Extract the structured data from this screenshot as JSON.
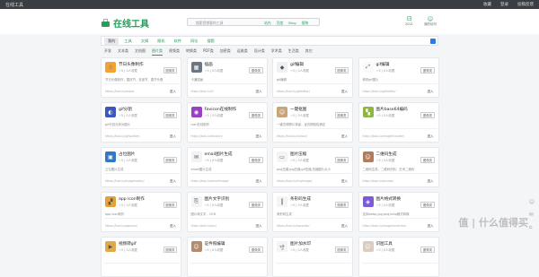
{
  "topbar": {
    "title": "在线工具",
    "links": [
      "收藏",
      "登录",
      "投稿反馈"
    ]
  },
  "header": {
    "logo_text": "在线工具",
    "search_placeholder": "搜索您想要的工具",
    "search_tabs": [
      "站内",
      "百度",
      "Bing",
      "搜狗"
    ],
    "date_label": "2021",
    "date_glyph": "日",
    "visitor_label": "我的访问",
    "visitor_glyph": "☺"
  },
  "nav": {
    "items": [
      "我的",
      "工具",
      "文摘",
      "随机",
      "软件",
      "网址",
      "搜题"
    ]
  },
  "subnav": {
    "items": [
      "开发",
      "文本类",
      "文档图",
      "图片类",
      "视频类",
      "转换类",
      "PDF类",
      "加密类",
      "运维类",
      "设计类",
      "学术类",
      "生活类",
      "其它"
    ]
  },
  "cards": [
    {
      "name": "节日头像制作",
      "meta": "☆5 | 0人收藏",
      "tag": "图像类",
      "desc": "节日头像制作，国庆节、圣诞节、春节头像",
      "url": "https://tool.lu/avatar",
      "go": "进入",
      "color": "#f3a238",
      "glyph": "☃"
    },
    {
      "name": "插画",
      "meta": "☆5 | 0人收藏",
      "tag": "图像类",
      "desc": "卡通插画",
      "url": "https://tool.lu/ill",
      "go": "进入",
      "color": "#6b7784",
      "glyph": "▦"
    },
    {
      "name": "gif编辑",
      "meta": "☆5 | 0人收藏",
      "tag": "图像类",
      "desc": "gif编辑",
      "url": "https://tool.lu/gifeditor/",
      "go": "进入",
      "color": "#eef0f3",
      "glyph": "◆"
    },
    {
      "name": "gif编辑",
      "meta": "☆5 | 0人收藏",
      "tag": "图像类",
      "desc": "修改gif图片",
      "url": "https://tool.lu/gifeditor/",
      "go": "进入",
      "color": "#fafafa",
      "glyph": "⤢"
    },
    {
      "name": "gif分割",
      "meta": "☆5 | 0人收藏",
      "tag": "图像类",
      "desc": "gif分割分拆为图片",
      "url": "https://tool.lu/gifsplitter/",
      "go": "进入",
      "color": "#3a57c4",
      "glyph": "◐"
    },
    {
      "name": "Favicon在线制作",
      "meta": "☆5 | 0人收藏",
      "tag": "图像类",
      "desc": "icon在线制作",
      "url": "https://tool.lu/favicon/",
      "go": "进入",
      "color": "#9b3fc6",
      "glyph": "◉"
    },
    {
      "name": "一键抠图",
      "meta": "☆5 | 0人收藏",
      "tag": "图像类",
      "desc": "一键去掉照片背景，证件照轻松搞定",
      "url": "https://tool.lu/cutout/",
      "go": "进入",
      "color": "#c9a37a",
      "glyph": "☺"
    },
    {
      "name": "图片base64编码",
      "meta": "☆5 | 0人收藏",
      "tag": "图像类",
      "desc": "",
      "url": "https://tool.lu/imageEncoder/",
      "go": "进入",
      "color": "#8fb547",
      "glyph": "▚"
    },
    {
      "name": "占位图片",
      "meta": "☆5 | 0人收藏",
      "tag": "图像类",
      "desc": "占位图片生成",
      "url": "https://tool.lu/imageholder/",
      "go": "进入",
      "color": "#3178c6",
      "glyph": "▣"
    },
    {
      "name": "email图片生成",
      "meta": "☆5 | 0人收藏",
      "tag": "图像类",
      "desc": "email图片生成",
      "url": "https://tool.lu/emailimage/",
      "go": "进入",
      "color": "#f2f2f2",
      "glyph": "✉"
    },
    {
      "name": "图片压缩",
      "meta": "☆5 | 0人收藏",
      "tag": "图像类",
      "desc": "png压缩,jpg压缩,gif压缩,压缩图片大小",
      "url": "https://tool.lu/tinyimage/",
      "go": "进入",
      "color": "#f4f4f4",
      "glyph": "▭"
    },
    {
      "name": "二维码生成",
      "meta": "☆5 | 0人收藏",
      "tag": "图像类",
      "desc": "二维码生成，二维码识别，艺术二维码",
      "url": "https://tool.lu/qrcode/",
      "go": "进入",
      "color": "#b07c5c",
      "glyph": "☺"
    },
    {
      "name": "app icon制作",
      "meta": "☆5 | 0人收藏",
      "tag": "图像类",
      "desc": "app icon制作",
      "url": "https://tool.lu/appicon/",
      "go": "进入",
      "color": "#e6a13a",
      "glyph": "▞"
    },
    {
      "name": "图片文字识别",
      "meta": "☆5 | 0人收藏",
      "tag": "图像类",
      "desc": "图片转文字，OCR",
      "url": "https://tool.lu/ocr/",
      "go": "进入",
      "color": "#f4f4f4",
      "glyph": "⎘"
    },
    {
      "name": "条形码生成",
      "meta": "☆5 | 0人收藏",
      "tag": "图像类",
      "desc": "条形码生成",
      "url": "https://tool.lu/barcode/",
      "go": "进入",
      "color": "#f4f4f4",
      "glyph": "║"
    },
    {
      "name": "图片格式转换",
      "meta": "☆5 | 0人收藏",
      "tag": "图像类",
      "desc": "支持webp,jpg,png,bmp格式转换",
      "url": "https://tool.lu/imageconverter/",
      "go": "进入",
      "color": "#7c5cd6",
      "glyph": "◈"
    },
    {
      "name": "视频转gif",
      "meta": "☆5 | 0人收藏",
      "tag": "图像类",
      "desc": "",
      "url": "",
      "go": "",
      "color": "#e0a94a",
      "glyph": "▶"
    },
    {
      "name": "证件照编辑",
      "meta": "☆5 | 0人收藏",
      "tag": "图像类",
      "desc": "",
      "url": "",
      "go": "",
      "color": "#b58b6e",
      "glyph": "☺"
    },
    {
      "name": "图片加水印",
      "meta": "☆5 | 0人收藏",
      "tag": "图像类",
      "desc": "",
      "url": "",
      "go": "",
      "color": "#f4f4f4",
      "glyph": "寸"
    },
    {
      "name": "识图工具",
      "meta": "☆5 | 0人收藏",
      "tag": "图像类",
      "desc": "",
      "url": "",
      "go": "",
      "color": "#d8cdbf",
      "glyph": "☺"
    }
  ],
  "side_icons": [
    "☺",
    "✉",
    "⌂"
  ],
  "watermark": "值 | 什么值得买"
}
